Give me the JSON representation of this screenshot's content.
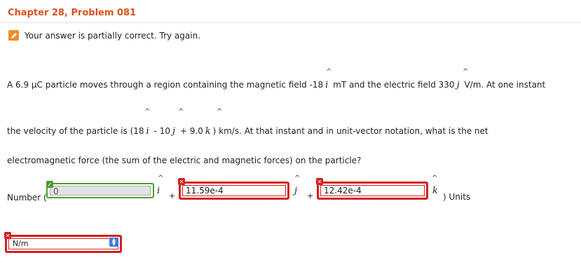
{
  "header": {
    "title": "Chapter 28, Problem 081"
  },
  "status": {
    "message": "Your answer is partially correct.  Try again.",
    "icon": "pencil-icon"
  },
  "problem": {
    "line1_a": "A 6.9 μC particle moves through a region containing the magnetic field -18",
    "line1_b": "mT and the electric field 330",
    "line1_c": "V/m. At one instant",
    "line2_a": "the velocity of the particle is (18",
    "line2_b": "- 10",
    "line2_c": "+ 9.0",
    "line2_d": ") km/s. At that instant and in unit-vector notation, what is the net",
    "line3": "electromagnetic force (the sum of the electric and magnetic forces) on the particle?"
  },
  "units_vectors": {
    "i": "i",
    "j": "j",
    "k": "k",
    "hat": "^"
  },
  "answer": {
    "number_label": "Number (",
    "i_value": "0",
    "plus": "+",
    "j_value": "11.59e-4",
    "k_value": "12.42e-4",
    "units_label": ") Units",
    "unit_selected": "N/m"
  },
  "badges": {
    "correct": "✓",
    "incorrect": "✕"
  },
  "colors": {
    "title": "#d9531e",
    "correct": "#4aa02c",
    "incorrect": "#d51f1f",
    "pencil": "#f08c2a"
  }
}
